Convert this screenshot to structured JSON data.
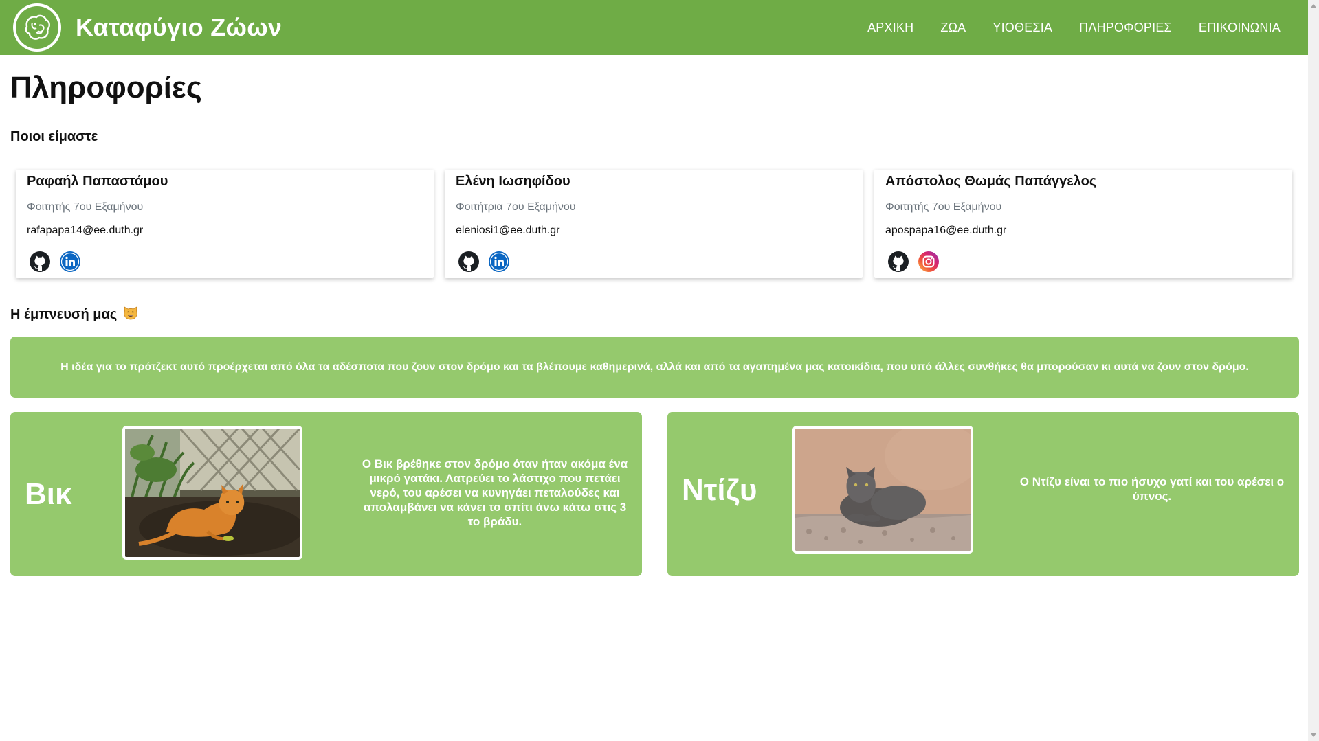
{
  "brand": {
    "title": "Καταφύγιο Ζώων",
    "logo_icon": "dog-logo-icon"
  },
  "nav": {
    "items": [
      {
        "label": "ΑΡΧΙΚΗ"
      },
      {
        "label": "ΖΩΑ"
      },
      {
        "label": "ΥΙΟΘΕΣΙΑ"
      },
      {
        "label": "ΠΛΗΡΟΦΟΡΙΕΣ"
      },
      {
        "label": "ΕΠΙΚΟΙΝΩΝΙΑ"
      }
    ]
  },
  "main": {
    "title": "Πληροφορίες",
    "who_title": "Ποιοι είμαστε",
    "team": [
      {
        "name": "Ραφαήλ Παπαστάμου",
        "role": "Φοιτητής 7ου Εξαμήνου",
        "email": "rafapapa14@ee.duth.gr",
        "icons": [
          "github-icon",
          "linkedin-icon"
        ]
      },
      {
        "name": "Ελένη Ιωσηφίδου",
        "role": "Φοιτήτρια 7ου Εξαμήνου",
        "email": "eleniosi1@ee.duth.gr",
        "icons": [
          "github-icon",
          "linkedin-icon"
        ]
      },
      {
        "name": "Απόστολος Θωμάς Παπάγγελος",
        "role": "Φοιτητής 7ου Εξαμήνου",
        "email": "apospapa16@ee.duth.gr",
        "icons": [
          "github-icon",
          "instagram-icon"
        ]
      }
    ],
    "inspiration_title": "Η έμπνευσή μας",
    "inspiration_emoji": "😸",
    "inspiration_text": "Η ιδέα για το πρότζεκτ αυτό προέρχεται από όλα τα αδέσποτα που ζουν στον δρόμο και τα βλέπουμε καθημερινά, αλλά και από τα αγαπημένα μας κατοικίδια, που υπό άλλες συνθήκες θα μπορούσαν κι αυτά να ζουν στον δρόμο.",
    "pets": [
      {
        "name": "Βικ",
        "description": "Ο Βικ βρέθηκε στον δρόμο όταν ήταν ακόμα ένα μικρό γατάκι. Λατρεύει το λάστιχο που πετάει νερό, του αρέσει να κυνηγάει πεταλούδες και απολαμβάνει να κάνει το σπίτι άνω κάτω στις 3 το βράδυ."
      },
      {
        "name": "Ντίζυ",
        "description": "Ο Ντίζυ είναι το πιο ήσυχο γατί και του αρέσει ο ύπνος."
      }
    ]
  },
  "colors": {
    "navbar": "#6fac46",
    "card_green": "#95c96d",
    "white": "#ffffff"
  }
}
